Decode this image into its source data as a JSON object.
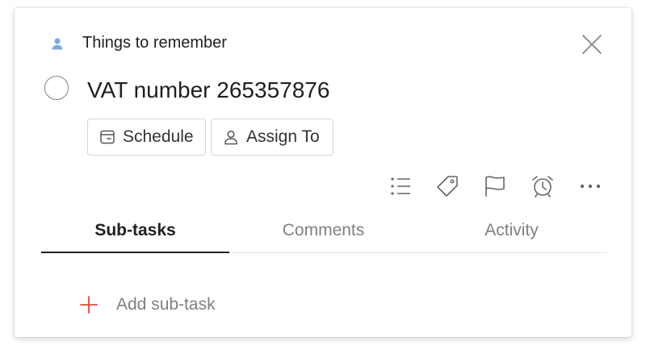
{
  "task": {
    "project_name": "Things to remember",
    "title": "VAT number 265357876"
  },
  "actions": {
    "schedule_label": "Schedule",
    "assign_label": "Assign To"
  },
  "toolbar_icons": [
    "subtasks-list-icon",
    "label-tag-icon",
    "priority-flag-icon",
    "reminder-alarm-icon",
    "more-options-icon"
  ],
  "tabs": [
    {
      "label": "Sub-tasks",
      "active": true
    },
    {
      "label": "Comments",
      "active": false
    },
    {
      "label": "Activity",
      "active": false
    }
  ],
  "subtasks": {
    "add_label": "Add sub-task"
  },
  "colors": {
    "accent": "#dd4b39",
    "project_icon": "#7ea9dd",
    "muted_text": "#808080"
  }
}
